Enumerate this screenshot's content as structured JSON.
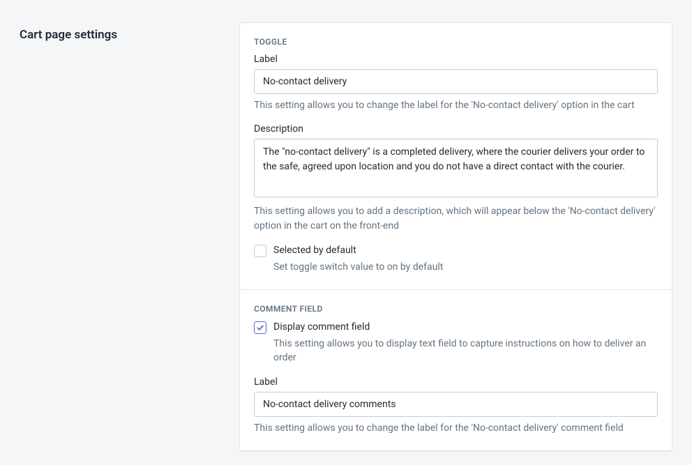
{
  "page": {
    "title": "Cart page settings"
  },
  "toggle": {
    "header": "Toggle",
    "label_field_label": "Label",
    "label_value": "No-contact delivery",
    "label_help": "This setting allows you to change the label for the 'No-contact delivery' option in the cart",
    "desc_field_label": "Description",
    "desc_value": "The \"no-contact delivery\" is a completed delivery, where the courier delivers your order to the safe, agreed upon location and you do not have a direct contact with the courier.",
    "desc_help": "This setting allows you to add a description, which will appear below the 'No-contact delivery' option in the cart on the front-end",
    "default_checked": false,
    "default_label": "Selected by default",
    "default_help": "Set toggle switch value to on by default"
  },
  "comment": {
    "header": "Comment field",
    "display_checked": true,
    "display_label": "Display comment field",
    "display_help": "This setting allows you to display text field to capture instructions on how to deliver an order",
    "label_field_label": "Label",
    "label_value": "No-contact delivery comments",
    "label_help": "This setting allows you to change the label for the 'No-contact delivery' comment field"
  }
}
